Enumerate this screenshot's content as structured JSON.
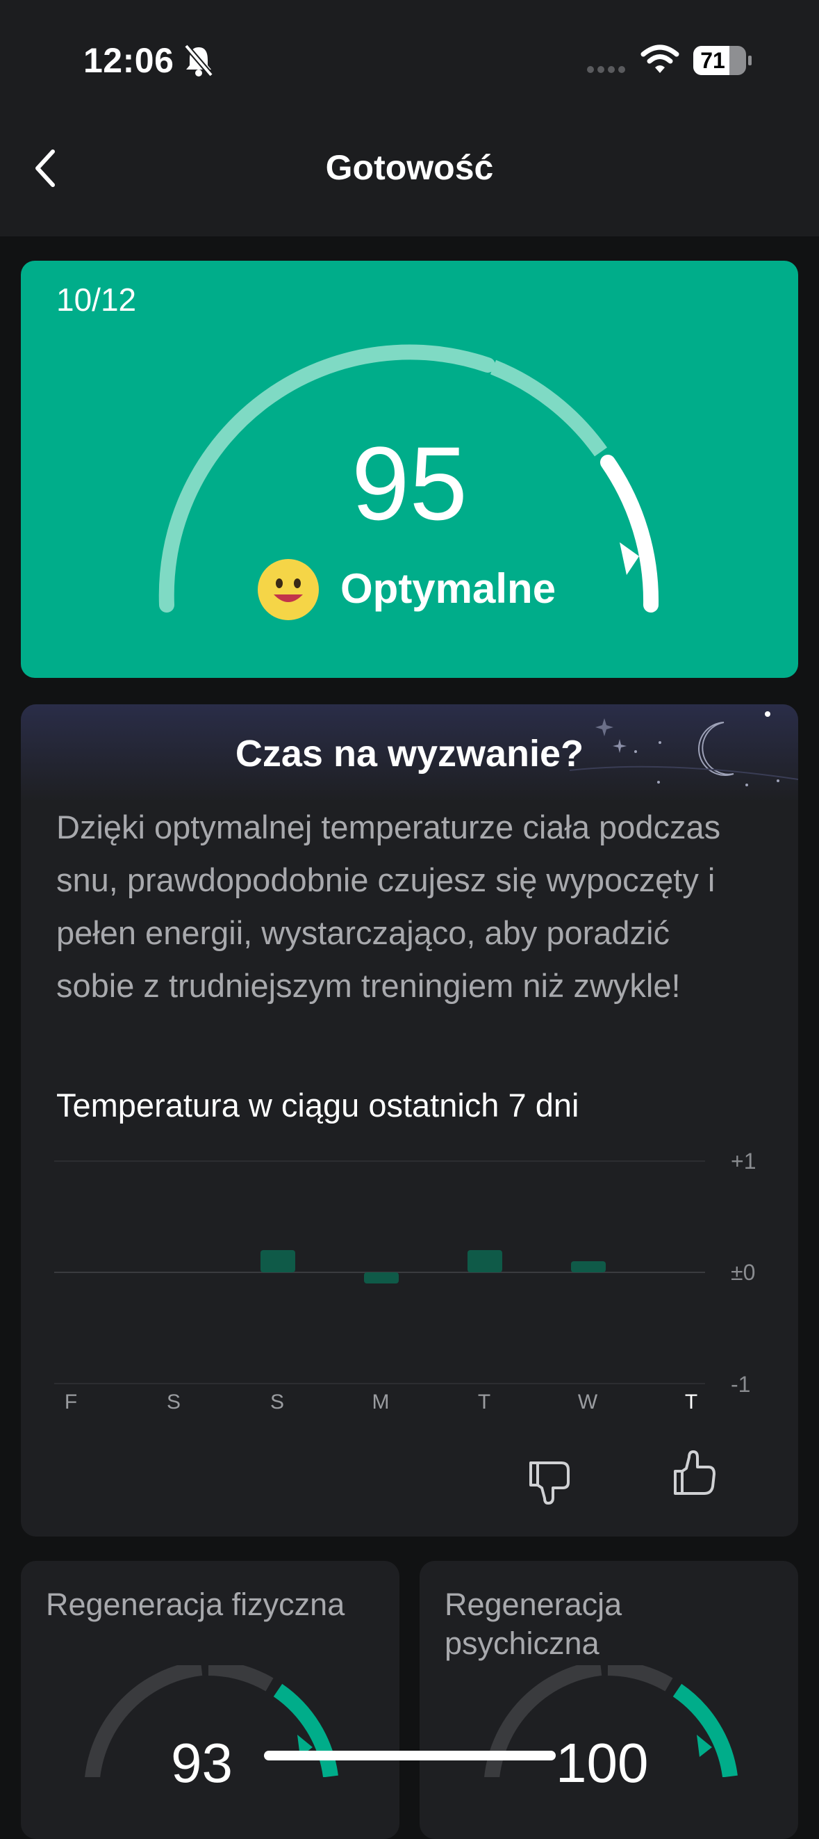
{
  "status": {
    "time": "12:06",
    "battery": "71"
  },
  "nav": {
    "title": "Gotowość"
  },
  "readiness": {
    "date": "10/12",
    "score": "95",
    "label": "Optymalne",
    "gauge_fraction": 0.95
  },
  "insight": {
    "title": "Czas na wyzwanie?",
    "body": "Dzięki optymalnej temperaturze ciała podczas snu, prawdopodobnie czujesz się wypoczęty i pełen energii, wystarczająco, aby poradzić sobie z trudniejszym treningiem niż zwykle!"
  },
  "chart_data": {
    "type": "bar",
    "title": "Temperatura w ciągu ostatnich 7 dni",
    "categories": [
      "F",
      "S",
      "S",
      "M",
      "T",
      "W",
      "T"
    ],
    "values": [
      0,
      0,
      0.2,
      -0.1,
      0.2,
      0.1,
      0
    ],
    "y_tick_labels": [
      "+1",
      "±0",
      "-1"
    ],
    "ylim": [
      -1,
      1
    ],
    "grid": true,
    "bar_color": "#0f5a48"
  },
  "physical": {
    "title": "Regeneracja fizyczna",
    "score": "93"
  },
  "mental": {
    "title": "Regeneracja psychiczna",
    "score": "100"
  }
}
